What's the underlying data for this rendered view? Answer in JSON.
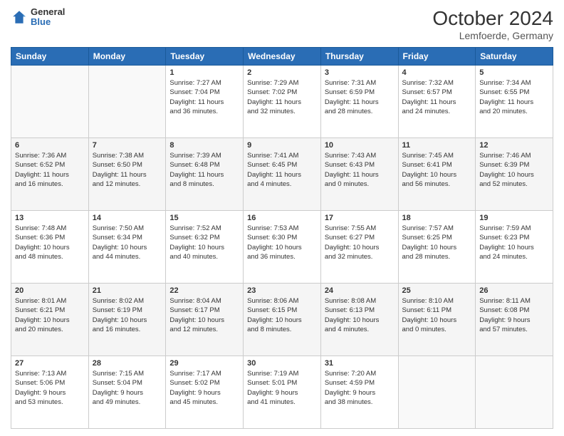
{
  "logo": {
    "general": "General",
    "blue": "Blue"
  },
  "title": "October 2024",
  "subtitle": "Lemfoerde, Germany",
  "days_of_week": [
    "Sunday",
    "Monday",
    "Tuesday",
    "Wednesday",
    "Thursday",
    "Friday",
    "Saturday"
  ],
  "weeks": [
    {
      "days": [
        {
          "num": "",
          "info": ""
        },
        {
          "num": "",
          "info": ""
        },
        {
          "num": "1",
          "info": "Sunrise: 7:27 AM\nSunset: 7:04 PM\nDaylight: 11 hours\nand 36 minutes."
        },
        {
          "num": "2",
          "info": "Sunrise: 7:29 AM\nSunset: 7:02 PM\nDaylight: 11 hours\nand 32 minutes."
        },
        {
          "num": "3",
          "info": "Sunrise: 7:31 AM\nSunset: 6:59 PM\nDaylight: 11 hours\nand 28 minutes."
        },
        {
          "num": "4",
          "info": "Sunrise: 7:32 AM\nSunset: 6:57 PM\nDaylight: 11 hours\nand 24 minutes."
        },
        {
          "num": "5",
          "info": "Sunrise: 7:34 AM\nSunset: 6:55 PM\nDaylight: 11 hours\nand 20 minutes."
        }
      ]
    },
    {
      "days": [
        {
          "num": "6",
          "info": "Sunrise: 7:36 AM\nSunset: 6:52 PM\nDaylight: 11 hours\nand 16 minutes."
        },
        {
          "num": "7",
          "info": "Sunrise: 7:38 AM\nSunset: 6:50 PM\nDaylight: 11 hours\nand 12 minutes."
        },
        {
          "num": "8",
          "info": "Sunrise: 7:39 AM\nSunset: 6:48 PM\nDaylight: 11 hours\nand 8 minutes."
        },
        {
          "num": "9",
          "info": "Sunrise: 7:41 AM\nSunset: 6:45 PM\nDaylight: 11 hours\nand 4 minutes."
        },
        {
          "num": "10",
          "info": "Sunrise: 7:43 AM\nSunset: 6:43 PM\nDaylight: 11 hours\nand 0 minutes."
        },
        {
          "num": "11",
          "info": "Sunrise: 7:45 AM\nSunset: 6:41 PM\nDaylight: 10 hours\nand 56 minutes."
        },
        {
          "num": "12",
          "info": "Sunrise: 7:46 AM\nSunset: 6:39 PM\nDaylight: 10 hours\nand 52 minutes."
        }
      ]
    },
    {
      "days": [
        {
          "num": "13",
          "info": "Sunrise: 7:48 AM\nSunset: 6:36 PM\nDaylight: 10 hours\nand 48 minutes."
        },
        {
          "num": "14",
          "info": "Sunrise: 7:50 AM\nSunset: 6:34 PM\nDaylight: 10 hours\nand 44 minutes."
        },
        {
          "num": "15",
          "info": "Sunrise: 7:52 AM\nSunset: 6:32 PM\nDaylight: 10 hours\nand 40 minutes."
        },
        {
          "num": "16",
          "info": "Sunrise: 7:53 AM\nSunset: 6:30 PM\nDaylight: 10 hours\nand 36 minutes."
        },
        {
          "num": "17",
          "info": "Sunrise: 7:55 AM\nSunset: 6:27 PM\nDaylight: 10 hours\nand 32 minutes."
        },
        {
          "num": "18",
          "info": "Sunrise: 7:57 AM\nSunset: 6:25 PM\nDaylight: 10 hours\nand 28 minutes."
        },
        {
          "num": "19",
          "info": "Sunrise: 7:59 AM\nSunset: 6:23 PM\nDaylight: 10 hours\nand 24 minutes."
        }
      ]
    },
    {
      "days": [
        {
          "num": "20",
          "info": "Sunrise: 8:01 AM\nSunset: 6:21 PM\nDaylight: 10 hours\nand 20 minutes."
        },
        {
          "num": "21",
          "info": "Sunrise: 8:02 AM\nSunset: 6:19 PM\nDaylight: 10 hours\nand 16 minutes."
        },
        {
          "num": "22",
          "info": "Sunrise: 8:04 AM\nSunset: 6:17 PM\nDaylight: 10 hours\nand 12 minutes."
        },
        {
          "num": "23",
          "info": "Sunrise: 8:06 AM\nSunset: 6:15 PM\nDaylight: 10 hours\nand 8 minutes."
        },
        {
          "num": "24",
          "info": "Sunrise: 8:08 AM\nSunset: 6:13 PM\nDaylight: 10 hours\nand 4 minutes."
        },
        {
          "num": "25",
          "info": "Sunrise: 8:10 AM\nSunset: 6:11 PM\nDaylight: 10 hours\nand 0 minutes."
        },
        {
          "num": "26",
          "info": "Sunrise: 8:11 AM\nSunset: 6:08 PM\nDaylight: 9 hours\nand 57 minutes."
        }
      ]
    },
    {
      "days": [
        {
          "num": "27",
          "info": "Sunrise: 7:13 AM\nSunset: 5:06 PM\nDaylight: 9 hours\nand 53 minutes."
        },
        {
          "num": "28",
          "info": "Sunrise: 7:15 AM\nSunset: 5:04 PM\nDaylight: 9 hours\nand 49 minutes."
        },
        {
          "num": "29",
          "info": "Sunrise: 7:17 AM\nSunset: 5:02 PM\nDaylight: 9 hours\nand 45 minutes."
        },
        {
          "num": "30",
          "info": "Sunrise: 7:19 AM\nSunset: 5:01 PM\nDaylight: 9 hours\nand 41 minutes."
        },
        {
          "num": "31",
          "info": "Sunrise: 7:20 AM\nSunset: 4:59 PM\nDaylight: 9 hours\nand 38 minutes."
        },
        {
          "num": "",
          "info": ""
        },
        {
          "num": "",
          "info": ""
        }
      ]
    }
  ]
}
